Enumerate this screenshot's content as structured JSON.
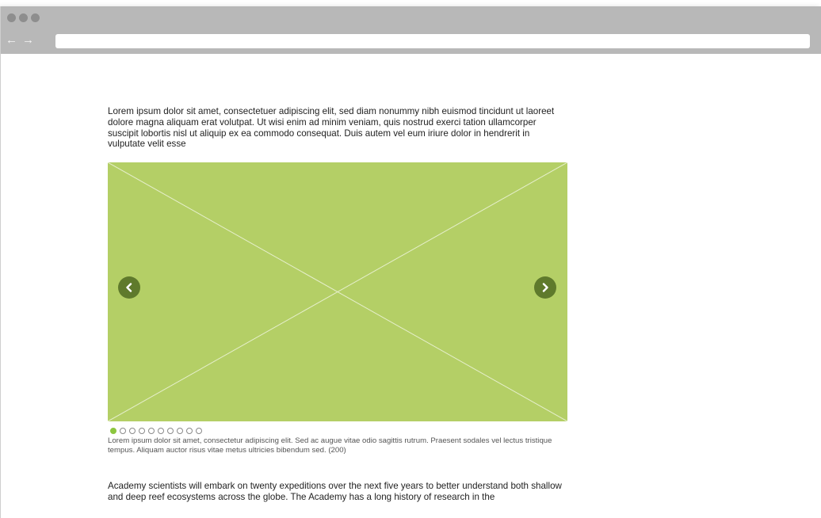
{
  "browser": {
    "back_glyph": "←",
    "forward_glyph": "→",
    "address": "",
    "icons": [
      "back-arrow-icon",
      "forward-arrow-icon"
    ]
  },
  "article": {
    "intro": "Lorem ipsum dolor sit amet, consectetuer adipiscing elit, sed diam nonummy nibh euismod tincidunt ut laoreet dolore magna aliquam erat volutpat. Ut wisi enim ad minim veniam, quis nostrud exerci tation ullamcorper suscipit lobortis nisl ut aliquip ex ea commodo consequat. Duis autem vel eum iriure dolor in hendrerit in vulputate velit esse",
    "body": "Academy scientists will embark on twenty expeditions over the next five years to better understand both shallow and deep reef ecosystems across the globe. The Academy has a long history of research in the"
  },
  "carousel": {
    "image_placeholder_color": "#b4cf66",
    "button_color": "#5f7a2c",
    "active_dot_color": "#8cc63f",
    "slide_count": 10,
    "active_index": 0,
    "prev_icon": "chevron-left-icon",
    "next_icon": "chevron-right-icon",
    "caption": "Lorem ipsum dolor sit amet, consectetur adipiscing elit. Sed ac augue vitae odio sagittis rutrum. Praesent sodales vel lectus tristique tempus. Aliquam auctor risus vitae metus ultricies bibendum sed. (200)"
  }
}
